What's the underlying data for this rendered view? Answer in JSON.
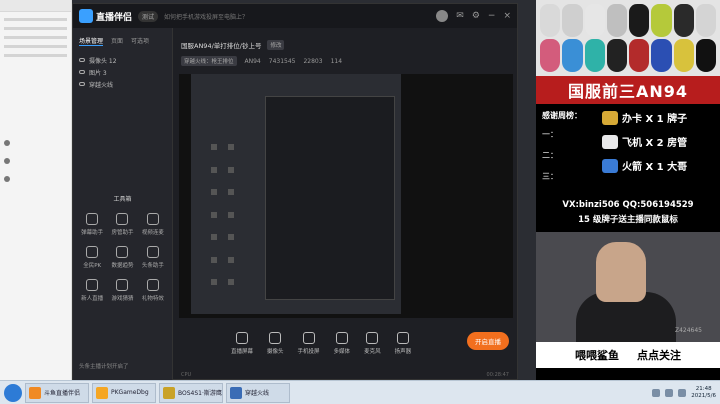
{
  "app": {
    "name": "直播伴侣",
    "version": "测试",
    "notice": "如何把手机游戏投屏至电脑上？"
  },
  "sidebar": {
    "tabs": [
      {
        "label": "场景管理"
      },
      {
        "label": "页面"
      },
      {
        "label": "可选项"
      }
    ],
    "sources": [
      {
        "label": "摄像头 12"
      },
      {
        "label": "图片 3"
      },
      {
        "label": "穿越火线"
      }
    ],
    "tools_title": "工具箱",
    "tools": [
      {
        "label": "弹幕助手"
      },
      {
        "label": "房管助手"
      },
      {
        "label": "视频连麦"
      },
      {
        "label": "全民PK"
      },
      {
        "label": "数据趋势"
      },
      {
        "label": "头条助手"
      },
      {
        "label": "新人直播"
      },
      {
        "label": "游戏猜猜"
      },
      {
        "label": "礼物特效"
      }
    ],
    "tip": "头条主播计划开启了"
  },
  "main": {
    "room_title": "国服AN94/单打排位/钞上号",
    "room_tag": "修改",
    "game": "穿越火线：枪王排位",
    "viewers": "AN94",
    "stat1": "7431545",
    "stat2": "22803",
    "stat3": "114"
  },
  "bottombar": {
    "buttons": [
      {
        "label": "直播屏幕"
      },
      {
        "label": "摄像头"
      },
      {
        "label": "手机投屏"
      },
      {
        "label": "多媒体"
      },
      {
        "label": "麦克风"
      },
      {
        "label": "扬声器"
      }
    ],
    "start_live": "开启直播",
    "cpu": "CPU",
    "time": "00:28:47"
  },
  "overlay": {
    "banner": "国服前三AN94",
    "thanks_label": "感谢周榜：",
    "ranks": [
      "一：",
      "二：",
      "三："
    ],
    "gifts": [
      {
        "text": "办卡 X 1 牌子"
      },
      {
        "text": "飞机 X 2 房管"
      },
      {
        "text": "火箭 X 1 大哥"
      }
    ],
    "contact": "VX:binzi506  QQ:506194529",
    "promo": "15 级牌子送主播同款鼠标",
    "cam_watermark": "Z424645",
    "caption_left": "喂喂鲨鱼",
    "caption_right": "点点关注"
  },
  "taskbar": {
    "items": [
      {
        "label": "斗鱼直播伴侣"
      },
      {
        "label": "PKGameDbg"
      },
      {
        "label": "BOS4S1·斯游鹰"
      },
      {
        "label": "穿越火线"
      }
    ],
    "clock_time": "21:48",
    "clock_date": "2021/5/6"
  }
}
